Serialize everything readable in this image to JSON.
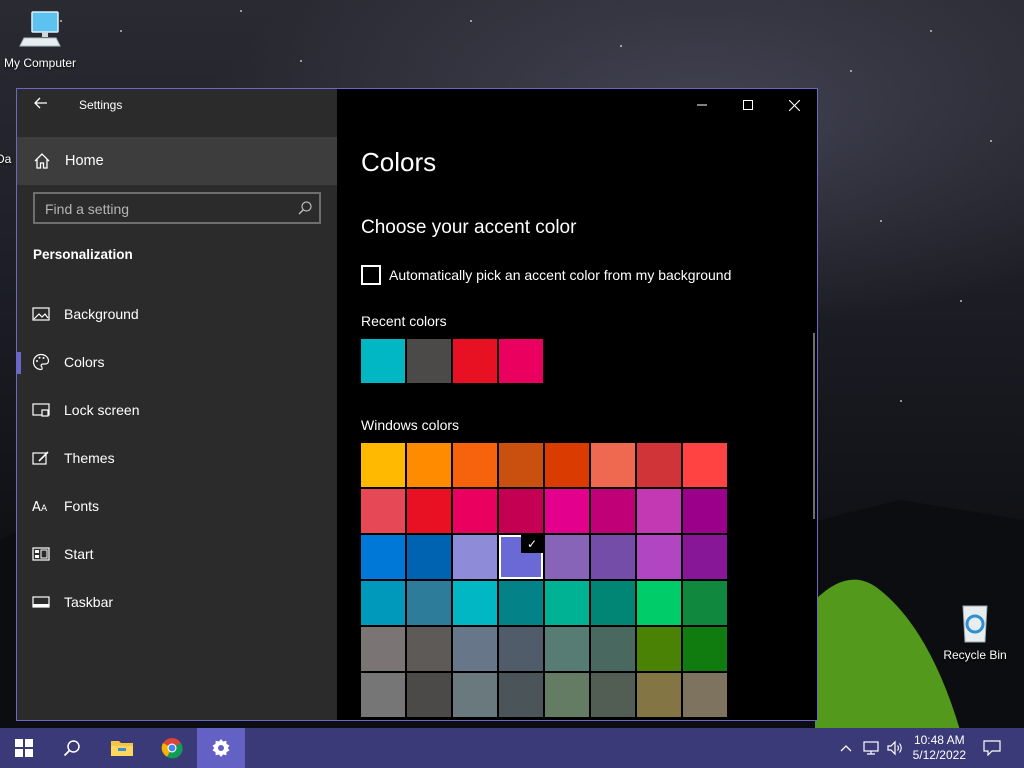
{
  "desktop": {
    "icons": [
      {
        "label": "My Computer"
      },
      {
        "label": "Recycle Bin"
      },
      {
        "label": "Da"
      }
    ]
  },
  "window": {
    "title": "Settings",
    "back_icon": "back-arrow-icon",
    "controls": [
      "minimize-icon",
      "maximize-icon",
      "close-icon"
    ],
    "border_color": "#6b67c9"
  },
  "sidebar": {
    "home_label": "Home",
    "search_placeholder": "Find a setting",
    "section": "Personalization",
    "items": [
      {
        "label": "Background",
        "icon": "picture-icon"
      },
      {
        "label": "Colors",
        "icon": "palette-icon",
        "active": true
      },
      {
        "label": "Lock screen",
        "icon": "lock-screen-icon"
      },
      {
        "label": "Themes",
        "icon": "themes-icon"
      },
      {
        "label": "Fonts",
        "icon": "fonts-icon"
      },
      {
        "label": "Start",
        "icon": "start-icon"
      },
      {
        "label": "Taskbar",
        "icon": "taskbar-icon"
      }
    ]
  },
  "content": {
    "title": "Colors",
    "accent_heading": "Choose your accent color",
    "auto_pick_label": "Automatically pick an accent color from my background",
    "auto_pick_checked": false,
    "recent_label": "Recent colors",
    "recent_colors": [
      "#00b7c3",
      "#4c4a48",
      "#e81123",
      "#ea005e"
    ],
    "windows_label": "Windows colors",
    "windows_colors": [
      [
        "#ffb900",
        "#ff8c00",
        "#f7630c",
        "#ca5010",
        "#da3b01",
        "#ef6950",
        "#d13438",
        "#ff4343"
      ],
      [
        "#e74856",
        "#e81123",
        "#ea005e",
        "#c30052",
        "#e3008c",
        "#bf0077",
        "#c239b3",
        "#9a0089"
      ],
      [
        "#0078d7",
        "#0063b1",
        "#8e8cd8",
        "#6b69d6",
        "#8764b8",
        "#744da9",
        "#b146c2",
        "#881798"
      ],
      [
        "#0099bc",
        "#2d7d9a",
        "#00b7c3",
        "#038387",
        "#00b294",
        "#018574",
        "#00cc6a",
        "#10893e"
      ],
      [
        "#7a7574",
        "#5d5a58",
        "#68768a",
        "#515c6b",
        "#567c73",
        "#486860",
        "#498205",
        "#107c10"
      ],
      [
        "#767676",
        "#4c4a48",
        "#69797e",
        "#4a5459",
        "#647c64",
        "#525e54",
        "#847545",
        "#7e735f"
      ]
    ],
    "selected_color": "#6b69d6",
    "check_mark": "✓"
  },
  "taskbar": {
    "items": [
      "windows-start-icon",
      "search-icon",
      "file-explorer-icon",
      "chrome-icon",
      "settings-icon"
    ],
    "active": "settings-icon",
    "tray_icons": [
      "chevron-up-icon",
      "network-icon",
      "volume-icon"
    ],
    "time": "10:48 AM",
    "date": "5/12/2022",
    "notification_icon": "notification-icon"
  }
}
